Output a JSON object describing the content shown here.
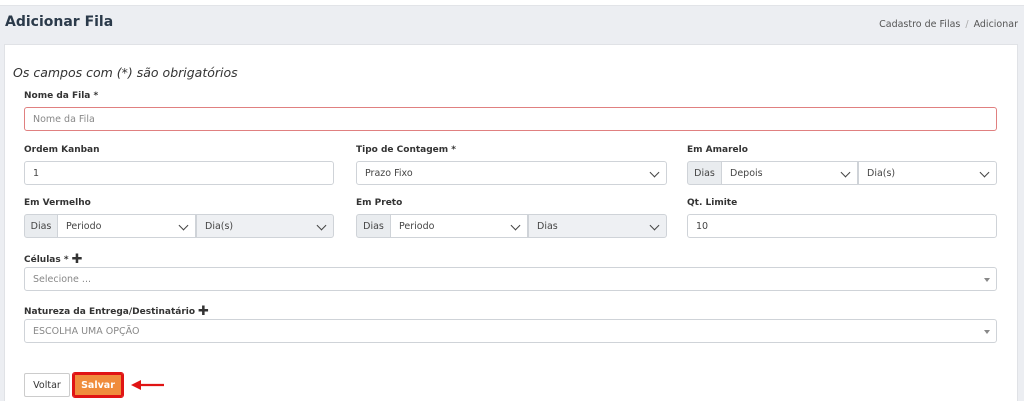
{
  "header": {
    "title": "Adicionar Fila",
    "breadcrumb": [
      "Cadastro de Filas",
      "Adicionar"
    ],
    "breadcrumb_sep": "/"
  },
  "form": {
    "required_note": "Os campos com (*) são obrigatórios",
    "nome": {
      "label": "Nome da Fila *",
      "placeholder": "Nome da Fila"
    },
    "ordem": {
      "label": "Ordem Kanban",
      "value": "1"
    },
    "tipo": {
      "label": "Tipo de Contagem *",
      "value": "Prazo Fixo"
    },
    "amarelo": {
      "label": "Em Amarelo",
      "addon": "Dias",
      "mode": "Depois",
      "unit": "Dia(s)"
    },
    "vermelho": {
      "label": "Em Vermelho",
      "addon": "Dias",
      "mode": "Periodo",
      "unit": "Dia(s)"
    },
    "preto": {
      "label": "Em Preto",
      "addon": "Dias",
      "mode": "Periodo",
      "unit": "Dias"
    },
    "limite": {
      "label": "Qt. Limite",
      "value": "10"
    },
    "celulas": {
      "label": "Células *",
      "placeholder": "Selecione ..."
    },
    "natureza": {
      "label": "Natureza da Entrega/Destinatário",
      "placeholder": "ESCOLHA UMA OPÇÃO"
    }
  },
  "buttons": {
    "back": "Voltar",
    "save": "Salvar"
  },
  "colors": {
    "save_bg": "#f08c3c",
    "highlight": "#e01414",
    "error_border": "#e08080"
  },
  "icons": [
    "plus-icon",
    "chevron-down-icon",
    "arrow-left-icon"
  ]
}
